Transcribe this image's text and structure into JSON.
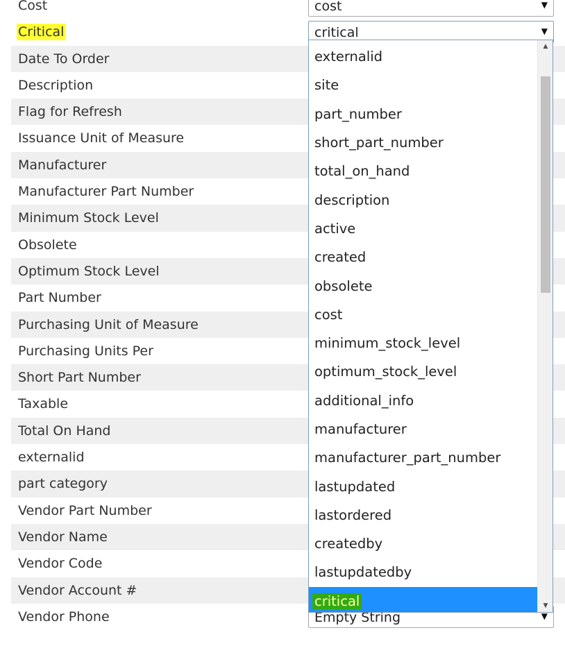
{
  "fields": [
    {
      "label": "Cost",
      "mapped": "cost"
    },
    {
      "label": "Critical",
      "mapped": "critical",
      "highlight": true,
      "open": true
    },
    {
      "label": "Date To Order"
    },
    {
      "label": "Description"
    },
    {
      "label": "Flag for Refresh"
    },
    {
      "label": "Issuance Unit of Measure"
    },
    {
      "label": "Manufacturer"
    },
    {
      "label": "Manufacturer Part Number"
    },
    {
      "label": "Minimum Stock Level"
    },
    {
      "label": "Obsolete"
    },
    {
      "label": "Optimum Stock Level"
    },
    {
      "label": "Part Number"
    },
    {
      "label": "Purchasing Unit of Measure"
    },
    {
      "label": "Purchasing Units Per"
    },
    {
      "label": "Short Part Number"
    },
    {
      "label": "Taxable"
    },
    {
      "label": "Total On Hand"
    },
    {
      "label": "externalid"
    },
    {
      "label": "part category"
    },
    {
      "label": "Vendor Part Number"
    },
    {
      "label": "Vendor Name"
    },
    {
      "label": "Vendor Code"
    },
    {
      "label": "Vendor Account #"
    },
    {
      "label": "Vendor Phone",
      "mapped": "Empty String"
    }
  ],
  "dropdown": {
    "selected": "critical",
    "arrow_icon": "triangle-down",
    "options": [
      "externalid",
      "site",
      "part_number",
      "short_part_number",
      "total_on_hand",
      "description",
      "active",
      "created",
      "obsolete",
      "cost",
      "minimum_stock_level",
      "optimum_stock_level",
      "additional_info",
      "manufacturer",
      "manufacturer_part_number",
      "lastupdated",
      "lastordered",
      "createdby",
      "lastupdatedby",
      "critical"
    ]
  },
  "colors": {
    "highlight_yellow": "#ffff33",
    "option_active_blue": "#1e90ff",
    "option_active_text_bg": "#33aa11",
    "row_shade": "#efefef"
  }
}
